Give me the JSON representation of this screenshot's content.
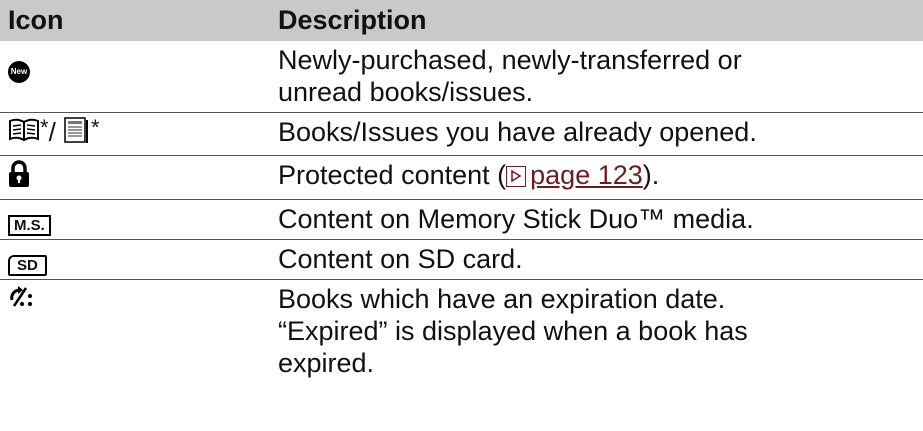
{
  "header": {
    "icon_col": "Icon",
    "desc_col": "Description"
  },
  "rows": [
    {
      "icon": "new-badge-icon",
      "badge_text": "New",
      "description": [
        "Newly-purchased, newly-transferred or",
        "unread books/issues."
      ]
    },
    {
      "icon": "opened-book-and-issue-icons",
      "star1": "*",
      "slash": "/ ",
      "star2": "*",
      "description": [
        "Books/Issues you have already opened."
      ]
    },
    {
      "icon": "lock-icon",
      "description_pre": "Protected content (",
      "link_text": "page 123",
      "description_post": ")."
    },
    {
      "icon": "memory-stick-icon",
      "badge_text": "M.S.",
      "description": [
        "Content on Memory Stick Duo™ media."
      ]
    },
    {
      "icon": "sd-card-icon",
      "badge_text": "SD",
      "description": [
        "Content on SD card."
      ]
    },
    {
      "icon": "expiration-icon",
      "description": [
        "Books which have an expiration date.",
        "“Expired” is displayed when a book has",
        "expired."
      ]
    }
  ]
}
